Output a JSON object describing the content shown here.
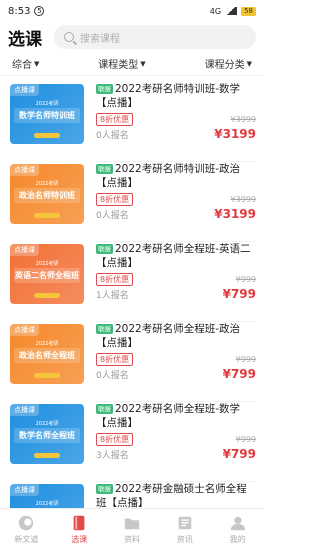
{
  "status": {
    "time": "8:53",
    "notif_count": "5",
    "network": "4G",
    "battery": "58"
  },
  "header": {
    "title": "选课",
    "search_placeholder": "搜索课程"
  },
  "filters": [
    {
      "label": "综合"
    },
    {
      "label": "课程类型"
    },
    {
      "label": "课程分类"
    }
  ],
  "courses": [
    {
      "thumb_tag": "点播课",
      "thumb_year": "2022考研",
      "thumb_title": "数学名师特训班",
      "thumb_color": "#1e8fe0",
      "badge": "联报",
      "title": "2022考研名师特训班-数学【点播】",
      "discount": "8折优惠",
      "original_price": "¥3999",
      "enrolled": "0人报名",
      "price": "¥3199"
    },
    {
      "thumb_tag": "点播课",
      "thumb_year": "2022考研",
      "thumb_title": "政治名师特训班",
      "thumb_color": "#f5882a",
      "badge": "联报",
      "title": "2022考研名师特训班-政治【点播】",
      "discount": "8折优惠",
      "original_price": "¥3999",
      "enrolled": "0人报名",
      "price": "¥3199"
    },
    {
      "thumb_tag": "点播课",
      "thumb_year": "2022考研",
      "thumb_title": "英语二名师全程班",
      "thumb_color": "#f27035",
      "badge": "联报",
      "title": "2022考研名师全程班-英语二【点播】",
      "discount": "8折优惠",
      "original_price": "¥999",
      "enrolled": "1人报名",
      "price": "¥799"
    },
    {
      "thumb_tag": "点播课",
      "thumb_year": "2022考研",
      "thumb_title": "政治名师全程班",
      "thumb_color": "#f5882a",
      "badge": "联报",
      "title": "2022考研名师全程班-政治【点播】",
      "discount": "8折优惠",
      "original_price": "¥999",
      "enrolled": "0人报名",
      "price": "¥799"
    },
    {
      "thumb_tag": "点播课",
      "thumb_year": "2022考研",
      "thumb_title": "数学名师全程班",
      "thumb_color": "#1e8fe0",
      "badge": "联报",
      "title": "2022考研名师全程班-数学【点播】",
      "discount": "8折优惠",
      "original_price": "¥999",
      "enrolled": "3人报名",
      "price": "¥799"
    },
    {
      "thumb_tag": "点播课",
      "thumb_year": "2022考研",
      "thumb_title": "金融硕士名师全程班",
      "thumb_color": "#1e8fe0",
      "badge": "联报",
      "title": "2022考研金融硕士名师全程班【点播】",
      "discount": "",
      "original_price": "",
      "enrolled": "",
      "price": ""
    }
  ],
  "tabs": [
    {
      "label": "新文道",
      "icon": "home-logo-icon",
      "active": false
    },
    {
      "label": "选课",
      "icon": "book-icon",
      "active": true
    },
    {
      "label": "资料",
      "icon": "folder-icon",
      "active": false
    },
    {
      "label": "资讯",
      "icon": "news-icon",
      "active": false
    },
    {
      "label": "我的",
      "icon": "user-icon",
      "active": false
    }
  ],
  "colors": {
    "accent": "#e24b4b",
    "badge_green": "#3cb979",
    "price_red": "#e0393e"
  }
}
